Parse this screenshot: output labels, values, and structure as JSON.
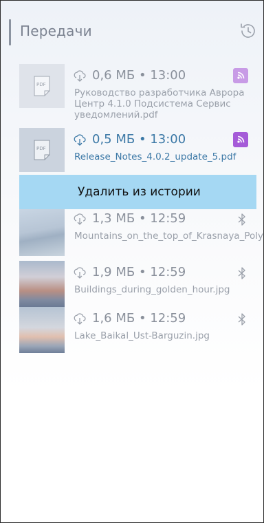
{
  "header": {
    "title": "Передачи",
    "history_icon": "history-clock-icon"
  },
  "context_menu": {
    "delete_label": "Удалить из истории"
  },
  "transfers": [
    {
      "size_time": "0,6 МБ • 13:00",
      "name": "Руководство разработчика Аврора Центр 4.1.0 Подсистема Сервис уведомлений.pdf",
      "type": "pdf",
      "channel": "push-service",
      "active": false
    },
    {
      "size_time": "0,5 МБ • 13:00",
      "name": "Release_Notes_4.0.2_update_5.pdf",
      "type": "pdf",
      "channel": "push-service",
      "active": true
    },
    {
      "size_time": "1,3 МБ • 12:59",
      "name": "Mountains_on_the_top_of_Krasnaya_Polyana_in_Sochi.jpg",
      "type": "image",
      "channel": "bluetooth",
      "active": false
    },
    {
      "size_time": "1,9 МБ • 12:59",
      "name": "Buildings_during_golden_hour.jpg",
      "type": "image",
      "channel": "bluetooth",
      "active": false
    },
    {
      "size_time": "1,6 МБ • 12:59",
      "name": "Lake_Baikal_Ust-Barguzin.jpg",
      "type": "image",
      "channel": "bluetooth",
      "active": false
    }
  ],
  "thumb_text": "PDF"
}
